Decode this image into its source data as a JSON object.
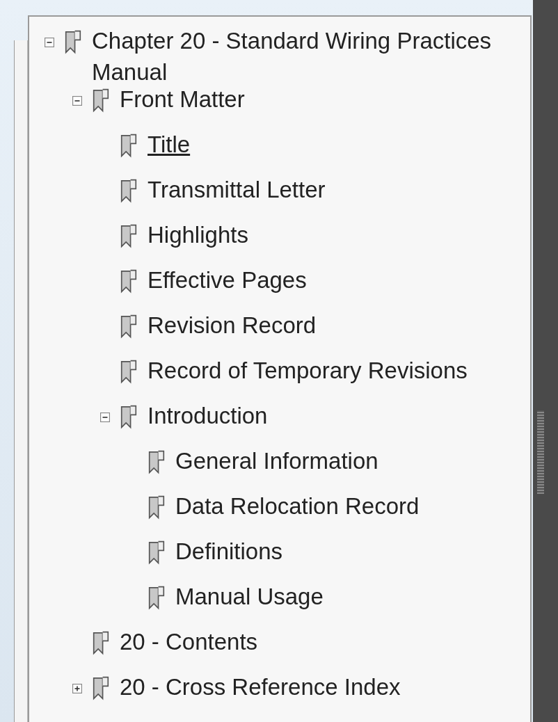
{
  "bookmarks": [
    {
      "label": "Chapter 20 - Standard Wiring Practices Manual",
      "hovered": false,
      "expanded": true,
      "children": [
        {
          "label": "Front Matter",
          "hovered": false,
          "expanded": true,
          "children": [
            {
              "label": "Title",
              "hovered": true
            },
            {
              "label": "Transmittal Letter",
              "hovered": false
            },
            {
              "label": "Highlights",
              "hovered": false
            },
            {
              "label": "Effective Pages",
              "hovered": false
            },
            {
              "label": "Revision Record",
              "hovered": false
            },
            {
              "label": "Record of Temporary Revisions",
              "hovered": false
            },
            {
              "label": "Introduction",
              "hovered": false,
              "expanded": true,
              "children": [
                {
                  "label": "General Information",
                  "hovered": false
                },
                {
                  "label": "Data Relocation Record",
                  "hovered": false
                },
                {
                  "label": "Definitions",
                  "hovered": false
                },
                {
                  "label": "Manual Usage",
                  "hovered": false
                }
              ]
            }
          ]
        },
        {
          "label": "20 - Contents",
          "hovered": false
        },
        {
          "label": "20 - Cross Reference Index",
          "hovered": false,
          "expanded": false
        }
      ]
    }
  ]
}
